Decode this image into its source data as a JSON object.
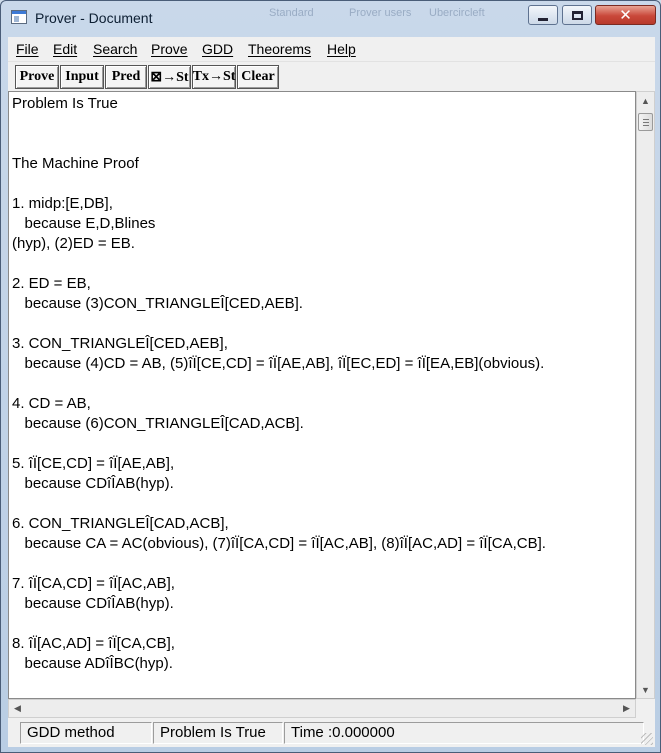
{
  "window": {
    "title": "Prover - Document",
    "ghost_tabs": [
      "Standard",
      "Prover users",
      "Ubercircleft"
    ]
  },
  "titlebar_buttons": {
    "minimize": "minimize-icon",
    "maximize": "maximize-icon",
    "close": "close-icon"
  },
  "menu": [
    "File",
    "Edit",
    "Search",
    "Prove",
    "GDD",
    "Theorems",
    "Help"
  ],
  "toolbar": [
    "Prove",
    "Input",
    "Pred",
    "⊠→St",
    "Tx→St",
    "Clear"
  ],
  "document": {
    "lines": [
      "Problem Is True",
      "",
      "",
      "The Machine Proof",
      "",
      "1. midp:[E,DB],",
      "   because E,D,Blines",
      "(hyp), (2)ED = EB.",
      "",
      "2. ED = EB,",
      "   because (3)CON_TRIANGLEÎ[CED,AEB].",
      "",
      "3. CON_TRIANGLEÎ[CED,AEB],",
      "   because (4)CD = AB, (5)îÏ[CE,CD] = îÏ[AE,AB], îÏ[EC,ED] = îÏ[EA,EB](obvious).",
      "",
      "4. CD = AB,",
      "   because (6)CON_TRIANGLEÎ[CAD,ACB].",
      "",
      "5. îÏ[CE,CD] = îÏ[AE,AB],",
      "   because CDîÎAB(hyp).",
      "",
      "6. CON_TRIANGLEÎ[CAD,ACB],",
      "   because CA = AC(obvious), (7)îÏ[CA,CD] = îÏ[AC,AB], (8)îÏ[AC,AD] = îÏ[CA,CB].",
      "",
      "7. îÏ[CA,CD] = îÏ[AC,AB],",
      "   because CDîÎAB(hyp).",
      "",
      "8. îÏ[AC,AD] = îÏ[CA,CB],",
      "   because ADîÎBC(hyp)."
    ]
  },
  "statusbar": [
    "GDD method",
    "Problem Is True",
    "Time :0.000000"
  ],
  "scroll": {
    "up": "scroll-up-icon",
    "down": "scroll-down-icon",
    "left": "scroll-left-icon",
    "right": "scroll-right-icon"
  }
}
